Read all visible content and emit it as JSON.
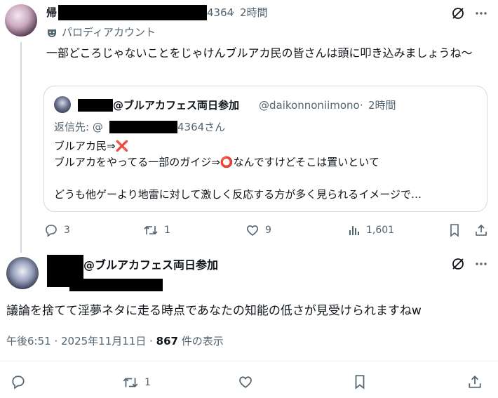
{
  "tweet1": {
    "name_visible": "帰",
    "handle_suffix": "4364",
    "time": "2時間",
    "parody_label": "パロディアカウント",
    "text": "一部どころじゃないことをじゃけんブルアカ民の皆さんは頭に叩き込みましょうね〜",
    "stats": {
      "replies": "3",
      "retweets": "1",
      "likes": "9",
      "views": "1,601"
    },
    "quote": {
      "name_suffix": "@ブルアカフェス両日参加",
      "handle": "@daikonnoniimono",
      "time": "2時間",
      "reply_prefix": "返信先: @",
      "reply_suffix": "4364さん",
      "line1": "ブルアカ民⇒❌",
      "line2": "ブルアカをやってる一部のガイジ⇒⭕なんですけどそこは置いといて",
      "line3": "どうも他ゲーより地雷に対して激しく反応する方が多く見られるイメージで…"
    }
  },
  "tweet2": {
    "name_suffix": "@ブルアカフェス両日参加",
    "text": "議論を捨てて淫夢ネタに走る時点であなたの知能の低さが見受けられますねw",
    "meta_time": "午後6:51 · 2025年11月11日 · ",
    "view_count": "867",
    "view_label": " 件の表示",
    "retweets": "1"
  },
  "dot_sep": "·",
  "colors": {
    "text": "#0f1419",
    "secondary": "#536471",
    "border": "#cfd9de",
    "danger": "#e0245e"
  }
}
